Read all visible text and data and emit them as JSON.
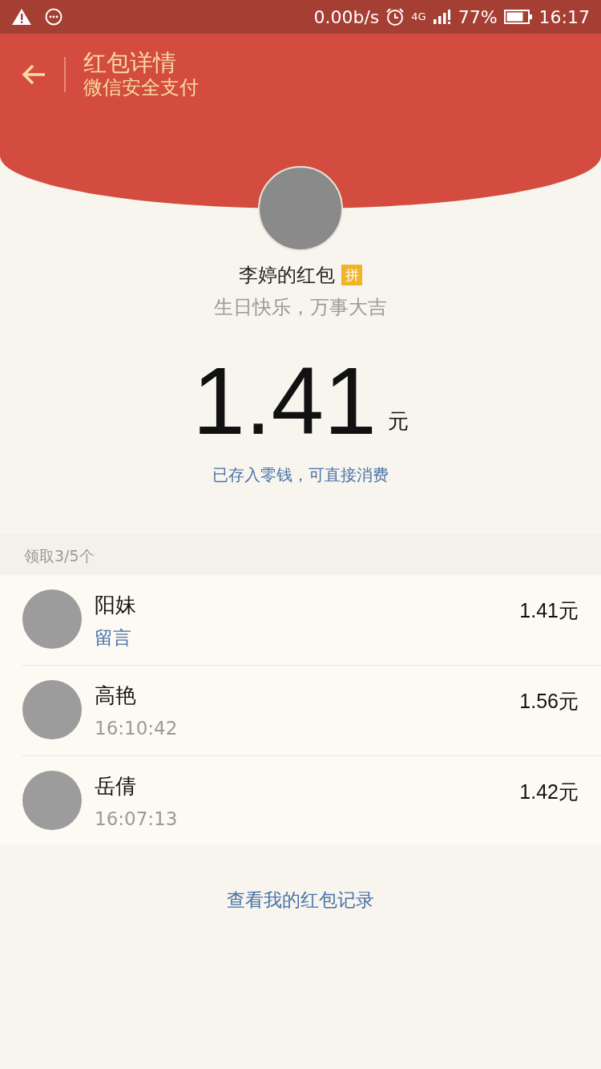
{
  "status_bar": {
    "speed": "0.00b/s",
    "network": "4G",
    "battery": "77%",
    "time": "16:17"
  },
  "header": {
    "title": "红包详情",
    "subtitle": "微信安全支付"
  },
  "packet": {
    "sender": "李婷的红包",
    "badge": "拼",
    "greeting": "生日快乐，万事大吉",
    "amount": "1.41",
    "unit": "元",
    "note": "已存入零钱，可直接消费"
  },
  "claims": {
    "label": "领取3/5个",
    "records": [
      {
        "name": "阳妹",
        "kind": "message",
        "detail": "留言",
        "amount": "1.41元"
      },
      {
        "name": "高艳",
        "kind": "time",
        "detail": "16:10:42",
        "amount": "1.56元"
      },
      {
        "name": "岳倩",
        "kind": "time",
        "detail": "16:07:13",
        "amount": "1.42元"
      }
    ]
  },
  "footer_link": "查看我的红包记录"
}
